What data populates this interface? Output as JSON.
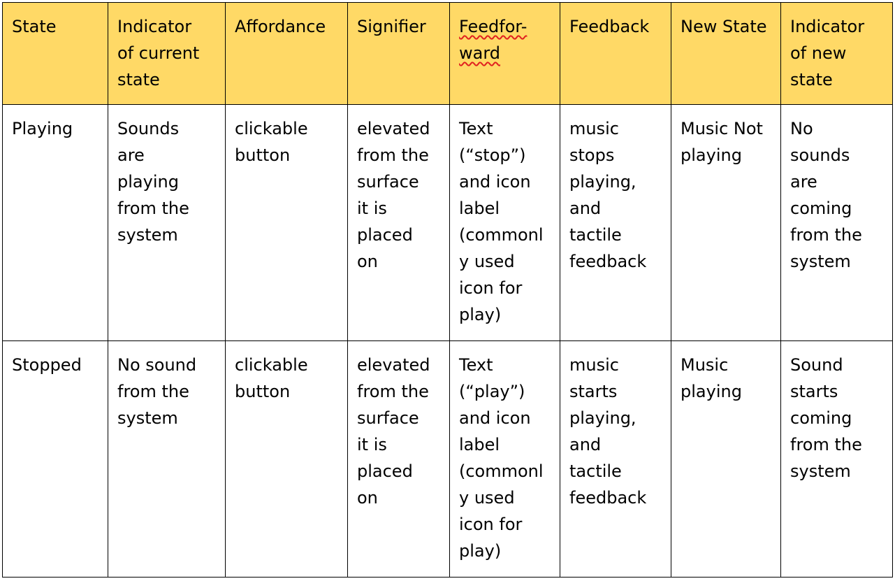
{
  "headers": [
    "State",
    "Indicator\nof current\nstate",
    "Affordance",
    "Signifier",
    "Feedfor-\nward",
    "Feedback",
    "New State",
    "Indicator\nof new\nstate"
  ],
  "rows": [
    [
      "Playing",
      "Sounds\nare\nplaying\nfrom the\nsystem",
      "clickable\nbutton",
      "elevated\nfrom the\nsurface\nit is\nplaced\non",
      "Text\n(“stop”)\nand icon\nlabel\n(commonl\ny used\nicon for\nplay)",
      "music\nstops\nplaying,\nand\ntactile\nfeedback",
      "Music Not\nplaying",
      "No\nsounds\nare\ncoming\nfrom the\nsystem"
    ],
    [
      "Stopped",
      "No sound\nfrom the\nsystem",
      "clickable\nbutton",
      "elevated\nfrom the\nsurface\nit is\nplaced\non",
      "Text\n(“play”)\nand icon\nlabel\n(commonl\ny used\nicon for\nplay)",
      "music\nstarts\nplaying,\nand\ntactile\nfeedback",
      "Music\nplaying",
      "Sound\nstarts\ncoming\nfrom the\nsystem"
    ]
  ],
  "colors": {
    "header_background": "#ffd966",
    "border": "#000000",
    "spellcheck_underline": "#e02020"
  }
}
